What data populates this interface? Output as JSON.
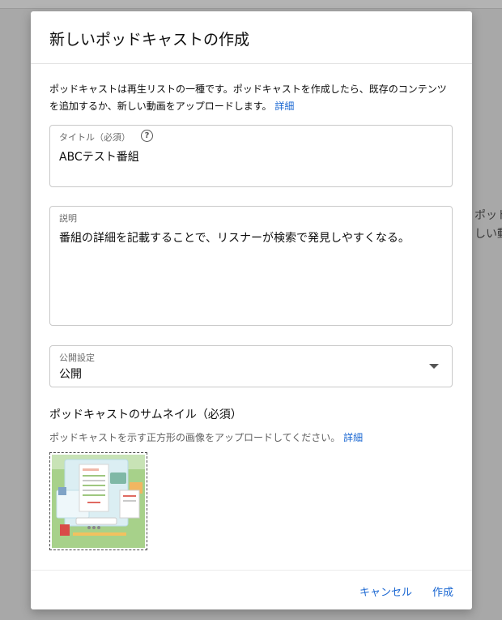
{
  "background": {
    "partial_lines": [
      "ポッド",
      "しい動"
    ]
  },
  "dialog": {
    "title": "新しいポッドキャストの作成",
    "intro_text": "ポッドキャストは再生リストの一種です。ポッドキャストを作成したら、既存のコンテンツを追加するか、新しい動画をアップロードします。",
    "intro_link": "詳細",
    "title_field": {
      "label": "タイトル（必須）",
      "value": "ABCテスト番組",
      "help_icon": "help-circle-icon"
    },
    "description_field": {
      "label": "説明",
      "value": "番組の詳細を記載することで、リスナーが検索で発見しやすくなる。"
    },
    "visibility_field": {
      "label": "公開設定",
      "value": "公開",
      "arrow_icon": "dropdown-arrow-icon"
    },
    "thumbnail": {
      "title": "ポッドキャストのサムネイル（必須）",
      "description": "ポッドキャストを示す正方形の画像をアップロードしてください。",
      "link": "詳細"
    },
    "buttons": {
      "cancel": "キャンセル",
      "create": "作成"
    }
  },
  "colors": {
    "accent": "#1a67d2",
    "overlay": "#a8a8a8"
  }
}
